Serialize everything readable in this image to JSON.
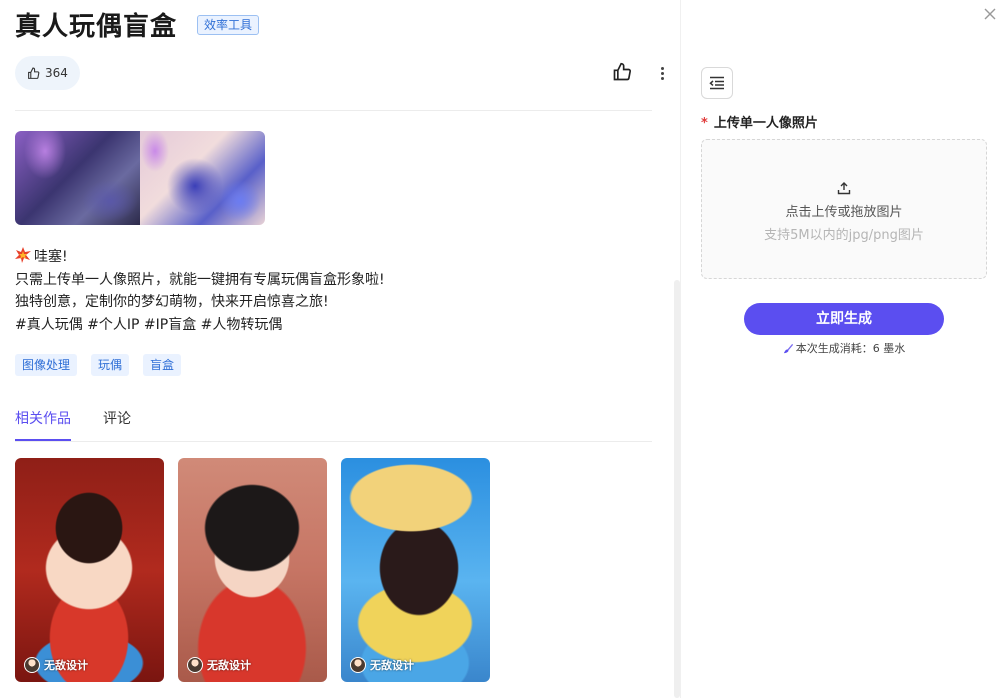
{
  "header": {
    "title": "真人玩偶盲盒",
    "badge": "效率工具"
  },
  "stats": {
    "likes": "364"
  },
  "description": {
    "line1": "哇塞!",
    "line2": "只需上传单一人像照片，就能一键拥有专属玩偶盲盒形象啦!",
    "line3": "独特创意，定制你的梦幻萌物，快来开启惊喜之旅!",
    "line4": "#真人玩偶 #个人IP #IP盲盒 #人物转玩偶"
  },
  "tags": [
    "图像处理",
    "玩偶",
    "盲盒"
  ],
  "tabs": [
    {
      "label": "相关作品",
      "active": true
    },
    {
      "label": "评论",
      "active": false
    }
  ],
  "works": [
    {
      "author": "无敌设计"
    },
    {
      "author": "无敌设计"
    },
    {
      "author": "无敌设计"
    }
  ],
  "form": {
    "upload_label": "上传单一人像照片",
    "required_mark": "*",
    "upload_hint": "点击上传或拖放图片",
    "upload_limit": "支持5M以内的jpg/png图片",
    "generate_label": "立即生成",
    "cost_text": "本次生成消耗：6 墨水"
  },
  "colors": {
    "accent": "#5b4ef0",
    "tag_text": "#2f6fd6",
    "tag_bg": "#eaf2ff",
    "required": "#e03a3a"
  }
}
